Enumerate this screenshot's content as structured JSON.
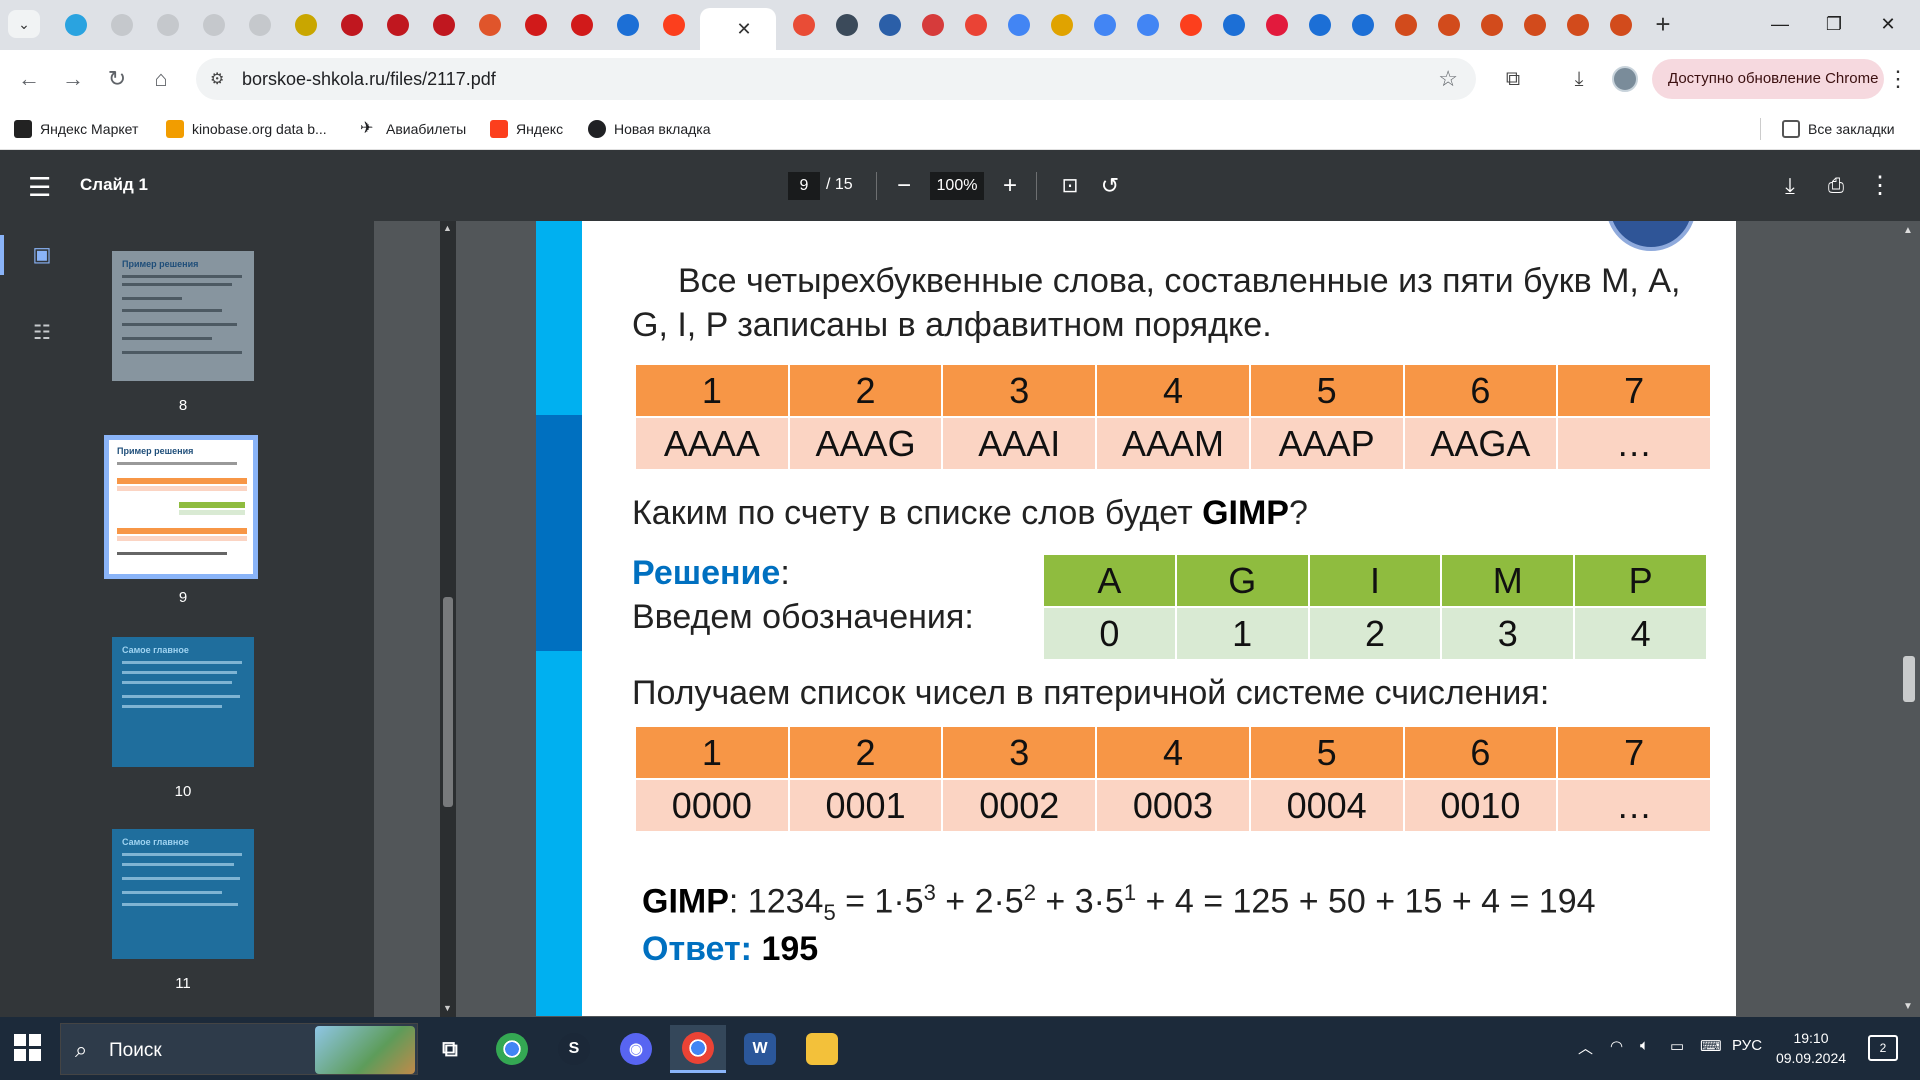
{
  "browser": {
    "active_tab_close": "✕",
    "new_tab": "+",
    "url": "borskoe-shkola.ru/files/2117.pdf",
    "update_chip": "Доступно обновление Chrome",
    "tab_favicons": [
      {
        "name": "telegram-tab",
        "color": "#2aa3e0"
      },
      {
        "name": "site-tab-1",
        "color": "#c5c8cc"
      },
      {
        "name": "site-tab-2",
        "color": "#c5c8cc"
      },
      {
        "name": "site-tab-3",
        "color": "#c5c8cc"
      },
      {
        "name": "site-tab-4",
        "color": "#c5c8cc"
      },
      {
        "name": "site-tab-5",
        "color": "#c9a600"
      },
      {
        "name": "site-tab-6",
        "color": "#c0171f"
      },
      {
        "name": "site-tab-7",
        "color": "#c0171f"
      },
      {
        "name": "site-tab-8",
        "color": "#c0171f"
      },
      {
        "name": "site-tab-9",
        "color": "#e0552b"
      },
      {
        "name": "site-tab-10",
        "color": "#d11a1a"
      },
      {
        "name": "site-tab-11",
        "color": "#d11a1a"
      },
      {
        "name": "site-tab-12",
        "color": "#1c6fd6"
      },
      {
        "name": "yandex-tab",
        "color": "#fc3f1d"
      }
    ],
    "tab_favicons_right": [
      {
        "name": "site-tab-13",
        "color": "#e94c36"
      },
      {
        "name": "site-tab-14",
        "color": "#3b4a5a"
      },
      {
        "name": "site-tab-15",
        "color": "#2b5fa8"
      },
      {
        "name": "site-tab-16",
        "color": "#d63b3b"
      },
      {
        "name": "gmail-tab",
        "color": "#ea4335"
      },
      {
        "name": "google-tab-1",
        "color": "#4285f4"
      },
      {
        "name": "site-tab-17",
        "color": "#e0a300"
      },
      {
        "name": "site-tab-18",
        "color": "#4285f4"
      },
      {
        "name": "google-tab-2",
        "color": "#4285f4"
      },
      {
        "name": "yandex-tab-2",
        "color": "#fc3f1d"
      },
      {
        "name": "site-tab-19",
        "color": "#1c6fd6"
      },
      {
        "name": "site-tab-20",
        "color": "#e21a3d"
      },
      {
        "name": "site-tab-21",
        "color": "#1c6fd6"
      },
      {
        "name": "site-tab-22",
        "color": "#1c6fd6"
      },
      {
        "name": "site-tab-23",
        "color": "#d24b1c"
      },
      {
        "name": "site-tab-24",
        "color": "#d24b1c"
      },
      {
        "name": "site-tab-25",
        "color": "#d24b1c"
      },
      {
        "name": "site-tab-26",
        "color": "#d24b1c"
      },
      {
        "name": "site-tab-27",
        "color": "#d24b1c"
      },
      {
        "name": "site-tab-28",
        "color": "#d24b1c"
      }
    ],
    "bookmarks": [
      {
        "label": "Яндекс Маркет",
        "color": "#222222"
      },
      {
        "label": "kinobase.org data b...",
        "color": "#f29d00"
      },
      {
        "label": "Авиабилеты",
        "color": "#333333"
      },
      {
        "label": "Яндекс",
        "color": "#fc3f1d"
      },
      {
        "label": "Новая вкладка",
        "color": "#202124"
      }
    ],
    "all_bookmarks": "Все закладки"
  },
  "pdf": {
    "title": "Слайд 1",
    "page_current": "9",
    "page_total": "/ 15",
    "zoom": "100%",
    "thumbnails": [
      {
        "num": "8",
        "title": "Пример решения"
      },
      {
        "num": "9",
        "title": "Пример решения"
      },
      {
        "num": "10",
        "title": "Самое главное"
      },
      {
        "num": "11",
        "title": "Самое главное"
      }
    ]
  },
  "slide": {
    "intro": "Все четырехбуквенные  слова, составленные из пяти букв М, А, G, I, P записаны в алфавитном порядке.",
    "table1": {
      "head": [
        "1",
        "2",
        "3",
        "4",
        "5",
        "6",
        "7"
      ],
      "row": [
        "АААА",
        "AAAG",
        "AAAI",
        "AAAM",
        "AAAP",
        "AAGA",
        "…"
      ]
    },
    "question_pre": "Каким по счету в списке слов будет ",
    "question_word": "GIMP",
    "question_post": "?",
    "solution_label": "Решение",
    "solution_colon": ":",
    "notation_label": "Введем обозначения:",
    "letters": {
      "head": [
        "A",
        "G",
        "I",
        "M",
        "P"
      ],
      "row": [
        "0",
        "1",
        "2",
        "3",
        "4"
      ]
    },
    "list_intro": "Получаем список чисел в пятеричной системе счисления:",
    "table2": {
      "head": [
        "1",
        "2",
        "3",
        "4",
        "5",
        "6",
        "7"
      ],
      "row": [
        "0000",
        "0001",
        "0002",
        "0003",
        "0004",
        "0010",
        "…"
      ]
    },
    "formula": {
      "word": "GIMP",
      "colon": ": 1234",
      "base": "5",
      "eq1": " = 1·5",
      "e1": "3",
      "p2": " + 2·5",
      "e2": "2",
      "p3": " + 3·5",
      "e3": "1",
      "rest": " + 4 = 125 + 50 + 15 + 4 = 194"
    },
    "answer_label": "Ответ: ",
    "answer_value": "195"
  },
  "taskbar": {
    "search_placeholder": "Поиск",
    "lang": "РУС",
    "time": "19:10",
    "date": "09.09.2024",
    "notif_count": "2"
  }
}
